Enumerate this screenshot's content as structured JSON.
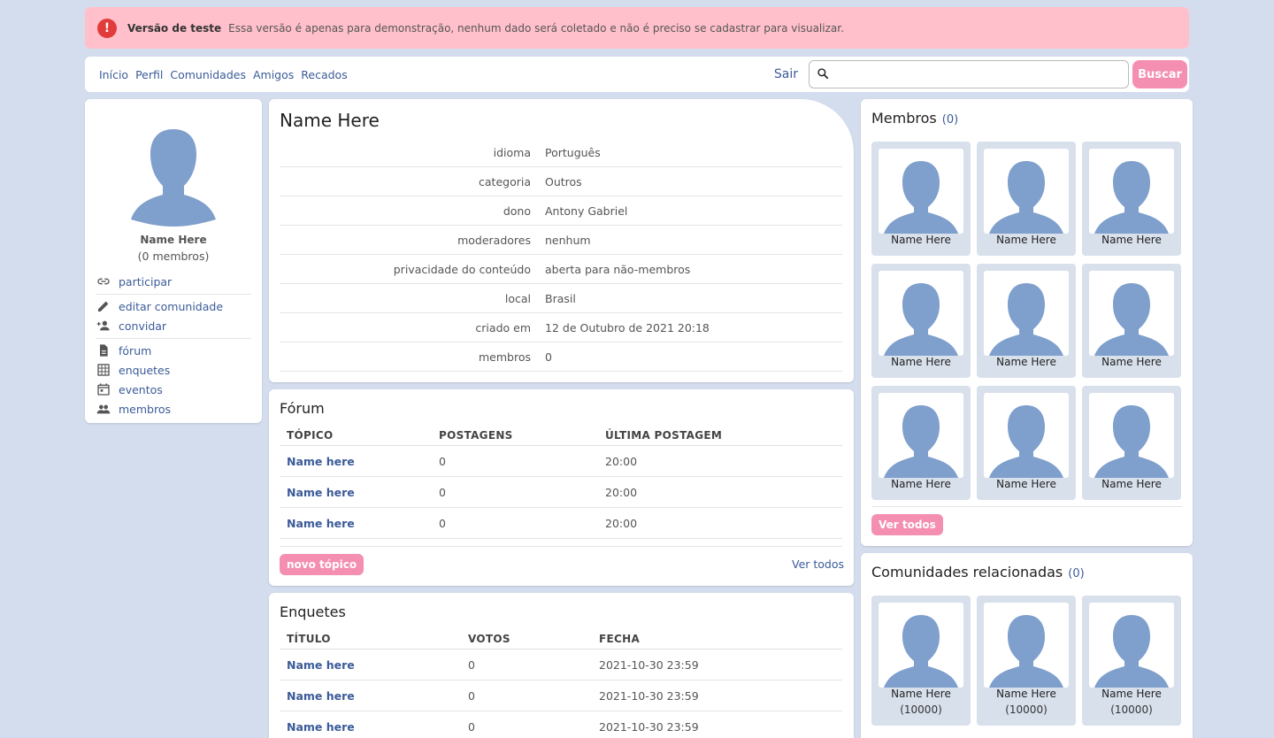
{
  "banner": {
    "icon": "alert-icon",
    "title": "Versão de teste",
    "text": "Essa versão é apenas para demonstração, nenhum dado será coletado e não é preciso se cadastrar para visualizar."
  },
  "nav": {
    "items": [
      "Início",
      "Perfil",
      "Comunidades",
      "Amigos",
      "Recados"
    ],
    "logout": "Sair",
    "search_placeholder": "",
    "search_button": "Buscar"
  },
  "profile": {
    "name": "Name Here",
    "members_count": "(0 membros)",
    "menu": {
      "participar": "participar",
      "editar": "editar comunidade",
      "convidar": "convidar",
      "forum": "fórum",
      "enquetes": "enquetes",
      "eventos": "eventos",
      "membros": "membros"
    }
  },
  "community": {
    "title": "Name Here",
    "rows": [
      {
        "k": "idioma",
        "v": "Português"
      },
      {
        "k": "categoria",
        "v": "Outros"
      },
      {
        "k": "dono",
        "v": "Antony Gabriel"
      },
      {
        "k": "moderadores",
        "v": "nenhum"
      },
      {
        "k": "privacidade do conteúdo",
        "v": "aberta para não-membros"
      },
      {
        "k": "local",
        "v": "Brasil"
      },
      {
        "k": "criado em",
        "v": "12 de Outubro de 2021 20:18"
      },
      {
        "k": "membros",
        "v": "0"
      }
    ]
  },
  "forum": {
    "title": "Fórum",
    "headers": [
      "TÓPICO",
      "POSTAGENS",
      "ÚLTIMA POSTAGEM"
    ],
    "rows": [
      [
        "Name here",
        "0",
        "20:00"
      ],
      [
        "Name here",
        "0",
        "20:00"
      ],
      [
        "Name here",
        "0",
        "20:00"
      ]
    ],
    "new_topic": "novo tópico",
    "see_all": "Ver todos"
  },
  "polls": {
    "title": "Enquetes",
    "headers": [
      "TÍTULO",
      "VOTOS",
      "FECHA"
    ],
    "rows": [
      [
        "Name here",
        "0",
        "2021-10-30 23:59"
      ],
      [
        "Name here",
        "0",
        "2021-10-30 23:59"
      ],
      [
        "Name here",
        "0",
        "2021-10-30 23:59"
      ]
    ]
  },
  "members": {
    "title": "Membros",
    "count": "(0)",
    "names": [
      "Name Here",
      "Name Here",
      "Name Here",
      "Name Here",
      "Name Here",
      "Name Here",
      "Name Here",
      "Name Here",
      "Name Here"
    ],
    "see_all": "Ver todos"
  },
  "related": {
    "title": "Comunidades relacionadas",
    "count": "(0)",
    "items": [
      {
        "name": "Name Here",
        "sub": "(10000)"
      },
      {
        "name": "Name Here",
        "sub": "(10000)"
      },
      {
        "name": "Name Here",
        "sub": "(10000)"
      }
    ]
  },
  "colors": {
    "background": "#d4ddee",
    "banner": "#ffc0cb",
    "accent_pink": "#f48fb1",
    "link": "#3b5b99",
    "avatar": "#7f9fcc"
  }
}
